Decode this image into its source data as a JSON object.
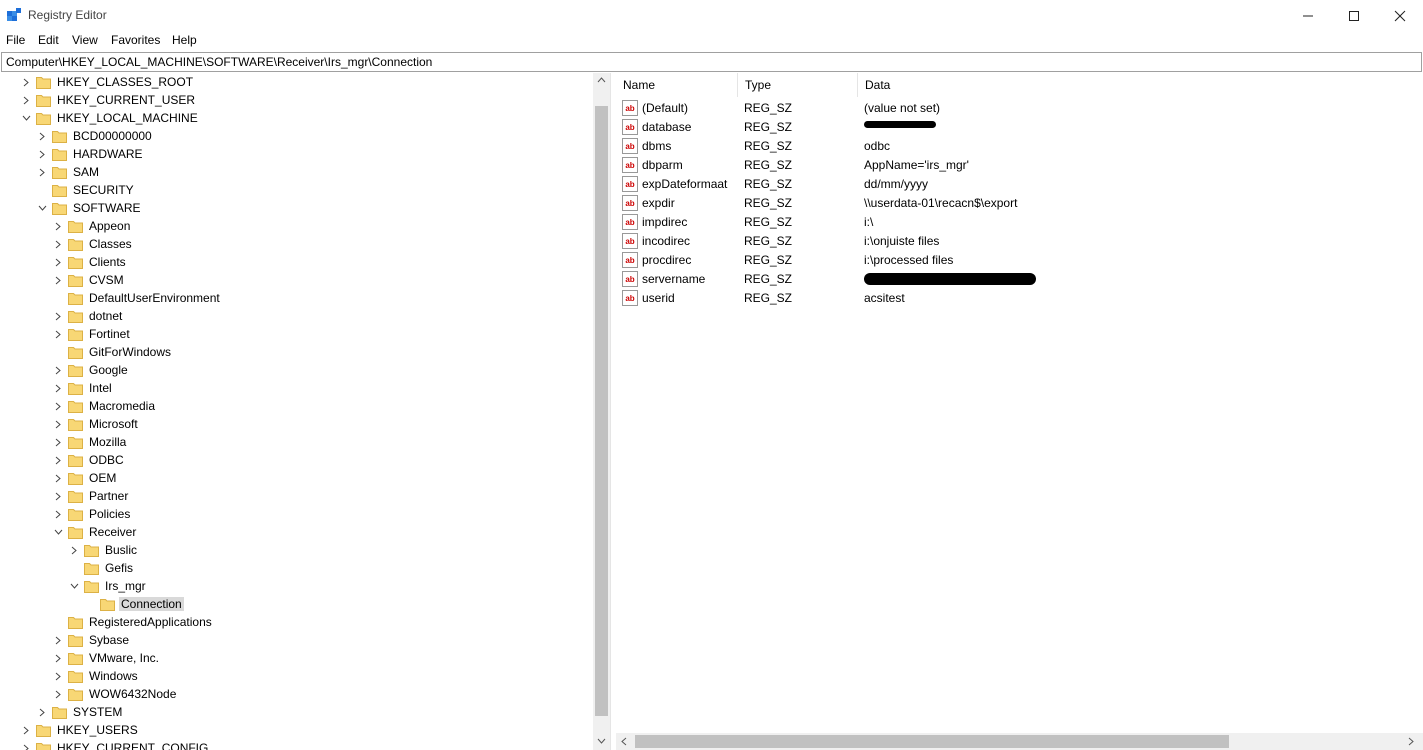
{
  "window": {
    "title": "Registry Editor"
  },
  "menu": [
    "File",
    "Edit",
    "View",
    "Favorites",
    "Help"
  ],
  "address": "Computer\\HKEY_LOCAL_MACHINE\\SOFTWARE\\Receiver\\Irs_mgr\\Connection",
  "tree": [
    {
      "label": "HKEY_CLASSES_ROOT",
      "depth": 0,
      "chev": "right"
    },
    {
      "label": "HKEY_CURRENT_USER",
      "depth": 0,
      "chev": "right"
    },
    {
      "label": "HKEY_LOCAL_MACHINE",
      "depth": 0,
      "chev": "down"
    },
    {
      "label": "BCD00000000",
      "depth": 1,
      "chev": "right"
    },
    {
      "label": "HARDWARE",
      "depth": 1,
      "chev": "right"
    },
    {
      "label": "SAM",
      "depth": 1,
      "chev": "right"
    },
    {
      "label": "SECURITY",
      "depth": 1,
      "chev": "none"
    },
    {
      "label": "SOFTWARE",
      "depth": 1,
      "chev": "down"
    },
    {
      "label": "Appeon",
      "depth": 2,
      "chev": "right"
    },
    {
      "label": "Classes",
      "depth": 2,
      "chev": "right"
    },
    {
      "label": "Clients",
      "depth": 2,
      "chev": "right"
    },
    {
      "label": "CVSM",
      "depth": 2,
      "chev": "right"
    },
    {
      "label": "DefaultUserEnvironment",
      "depth": 2,
      "chev": "none"
    },
    {
      "label": "dotnet",
      "depth": 2,
      "chev": "right"
    },
    {
      "label": "Fortinet",
      "depth": 2,
      "chev": "right"
    },
    {
      "label": "GitForWindows",
      "depth": 2,
      "chev": "none"
    },
    {
      "label": "Google",
      "depth": 2,
      "chev": "right"
    },
    {
      "label": "Intel",
      "depth": 2,
      "chev": "right"
    },
    {
      "label": "Macromedia",
      "depth": 2,
      "chev": "right"
    },
    {
      "label": "Microsoft",
      "depth": 2,
      "chev": "right"
    },
    {
      "label": "Mozilla",
      "depth": 2,
      "chev": "right"
    },
    {
      "label": "ODBC",
      "depth": 2,
      "chev": "right"
    },
    {
      "label": "OEM",
      "depth": 2,
      "chev": "right"
    },
    {
      "label": "Partner",
      "depth": 2,
      "chev": "right"
    },
    {
      "label": "Policies",
      "depth": 2,
      "chev": "right"
    },
    {
      "label": "Receiver",
      "depth": 2,
      "chev": "down"
    },
    {
      "label": "Buslic",
      "depth": 3,
      "chev": "right"
    },
    {
      "label": "Gefis",
      "depth": 3,
      "chev": "none"
    },
    {
      "label": "Irs_mgr",
      "depth": 3,
      "chev": "down"
    },
    {
      "label": "Connection",
      "depth": 4,
      "chev": "none",
      "selected": true
    },
    {
      "label": "RegisteredApplications",
      "depth": 2,
      "chev": "none"
    },
    {
      "label": "Sybase",
      "depth": 2,
      "chev": "right"
    },
    {
      "label": "VMware, Inc.",
      "depth": 2,
      "chev": "right"
    },
    {
      "label": "Windows",
      "depth": 2,
      "chev": "right"
    },
    {
      "label": "WOW6432Node",
      "depth": 2,
      "chev": "right"
    },
    {
      "label": "SYSTEM",
      "depth": 1,
      "chev": "right"
    },
    {
      "label": "HKEY_USERS",
      "depth": 0,
      "chev": "right"
    },
    {
      "label": "HKEY_CURRENT_CONFIG",
      "depth": 0,
      "chev": "right"
    }
  ],
  "columns": {
    "name": "Name",
    "type": "Type",
    "data": "Data"
  },
  "values": [
    {
      "name": "(Default)",
      "type": "REG_SZ",
      "data": "(value not set)"
    },
    {
      "name": "database",
      "type": "REG_SZ",
      "data": "",
      "redacted": true
    },
    {
      "name": "dbms",
      "type": "REG_SZ",
      "data": "odbc"
    },
    {
      "name": "dbparm",
      "type": "REG_SZ",
      "data": "AppName='irs_mgr'"
    },
    {
      "name": "expDateformaat",
      "type": "REG_SZ",
      "data": "dd/mm/yyyy"
    },
    {
      "name": "expdir",
      "type": "REG_SZ",
      "data": "\\\\userdata-01\\recacn$\\export"
    },
    {
      "name": "impdirec",
      "type": "REG_SZ",
      "data": "i:\\"
    },
    {
      "name": "incodirec",
      "type": "REG_SZ",
      "data": "i:\\onjuiste files"
    },
    {
      "name": "procdirec",
      "type": "REG_SZ",
      "data": "i:\\processed files"
    },
    {
      "name": "servername",
      "type": "REG_SZ",
      "data": "",
      "redacted": true
    },
    {
      "name": "userid",
      "type": "REG_SZ",
      "data": "acsitest"
    }
  ],
  "icons": {
    "value": "ab",
    "folder": "folder-icon"
  }
}
